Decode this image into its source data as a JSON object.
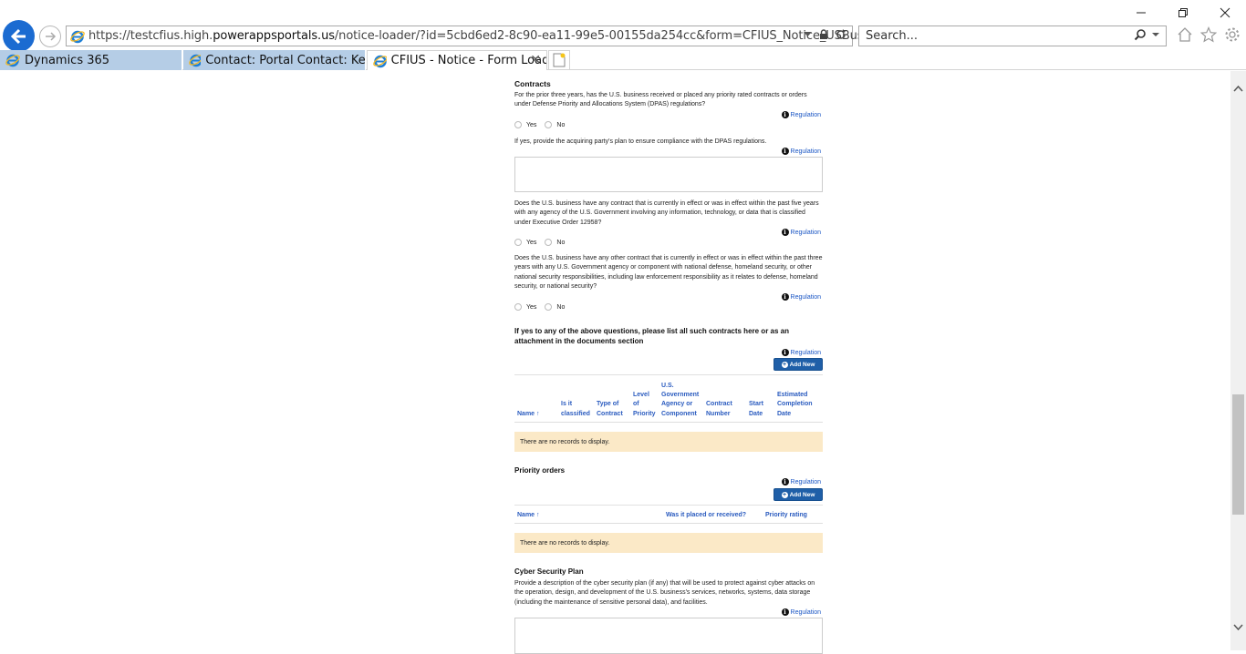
{
  "browser": {
    "address": {
      "prefix": "https://testcfius.high.",
      "domain": "powerappsportals.us",
      "path": "/notice-loader/?id=5cbd6ed2-8c90-ea11-99e5-00155da254cc&form=CFIUS_Notice_USBusiness_Details"
    },
    "search_placeholder": "Search...",
    "tabs": [
      {
        "label": "Dynamics 365",
        "active": false
      },
      {
        "label": "Contact: Portal Contact: Kevin ...",
        "active": false
      },
      {
        "label": "CFIUS - Notice - Form Load...",
        "active": true
      }
    ]
  },
  "page": {
    "contracts": {
      "title": "Contracts",
      "q1": "For the prior three years, has the U.S. business received or placed any priority rated contracts or orders under Defense Priority and Allocations System (DPAS) regulations?",
      "q1_yes": "Yes",
      "q1_no": "No",
      "q2": "If yes, provide the acquiring party's plan to ensure compliance with the DPAS regulations.",
      "q3": "Does the U.S. business have any contract that is currently in effect or was in effect within the past five years with any agency of the U.S. Government involving any information, technology, or data that is classified under Executive Order 12958?",
      "q3_yes": "Yes",
      "q3_no": "No",
      "q4": "Does the U.S. business have any other contract that is currently in effect or was in effect within the past three years with any U.S. Government agency or component with national defense, homeland security, or other national security responsibilities, including law enforcement responsibility as it relates to defense, homeland security, or national security?",
      "q4_yes": "Yes",
      "q4_no": "No",
      "list_heading": "If yes to any of the above questions, please list all such contracts here or as an attachment in the documents section",
      "add_new": "Add New",
      "columns": [
        "Name",
        "Is it classified",
        "Type of Contract",
        "Level of Priority",
        "U.S. Government Agency or Component",
        "Contract Number",
        "Start Date",
        "Estimated Completion Date"
      ],
      "sort_arrow": "↑",
      "empty": "There are no records to display."
    },
    "priority": {
      "title": "Priority orders",
      "add_new": "Add New",
      "columns": [
        "Name",
        "Was it placed or received?",
        "Priority rating"
      ],
      "sort_arrow": "↑",
      "empty": "There are no records to display."
    },
    "cyber": {
      "title": "Cyber Security Plan",
      "q": "Provide a description of the cyber security plan (if any) that will be used to protect against cyber attacks on the operation, design, and development of the U.S. business's services, networks, systems, data storage (including the maintenance of sensitive personal data), and facilities."
    },
    "regulation_label": "Regulation"
  }
}
